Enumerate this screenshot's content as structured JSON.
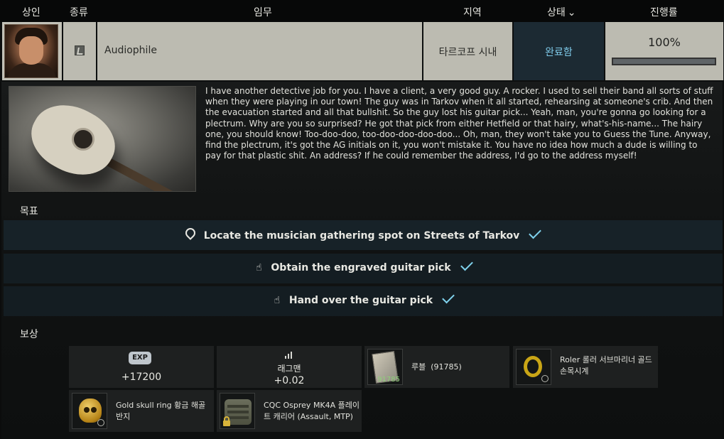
{
  "header": {
    "trader": "상인",
    "type": "종류",
    "task": "임무",
    "location": "지역",
    "status": "상태",
    "progress": "진행률"
  },
  "quest": {
    "trader_icon": "trader-portrait",
    "type_icon": "pickup-icon",
    "name": "Audiophile",
    "location": "타르코프 시내",
    "status": "완료함",
    "progress_text": "100%",
    "progress_fraction": 1.0,
    "status_color": "#7ec9e8"
  },
  "details": {
    "description": "I have another detective job for you. I have a client, a very good guy. A rocker. I used to sell their band all sorts of stuff when they were playing in our town! The guy was in Tarkov when it all started, rehearsing at someone's crib. And then the evacuation started and all that bullshit. So the guy lost his guitar pick... Yeah, man, you're gonna go looking for a plectrum. Why are you so surprised? He got that pick from either Hetfield or that hairy, what's-his-name... The hairy one, you should know! Too-doo-doo, too-doo-doo-doo-doo... Oh, man, they won't take you to Guess the Tune. Anyway, find the plectrum, it's got the AG initials on it, you won't mistake it. You have no idea how much a dude is willing to pay for that plastic shit. An address? If he could remember the address, I'd go to the address myself!",
    "objectives_label": "목표",
    "objectives": [
      {
        "text": "Locate the musician gathering spot on Streets of Tarkov",
        "icon": "location-pin-icon",
        "done": true
      },
      {
        "text": "Obtain the engraved guitar pick",
        "icon": "hand-pointer-icon",
        "done": true
      },
      {
        "text": "Hand over the guitar pick",
        "icon": "hand-pointer-icon",
        "done": true
      }
    ],
    "rewards_label": "보상",
    "rewards": {
      "exp_badge": "EXP",
      "exp_value": "+17200",
      "rep_trader": "래그맨",
      "rep_value": "+0.02",
      "roubles_label": "루블",
      "roubles_amount": "(91785)",
      "roubles_count": "91785",
      "watch_label": "Roler 롤러 서브마리너 골드 손목시계",
      "ring_label": "Gold skull ring 황금 해골 반지",
      "armor_label": "CQC Osprey MK4A 플레이트 캐리어 (Assault, MTP)"
    },
    "check_color": "#7fd1ec"
  }
}
